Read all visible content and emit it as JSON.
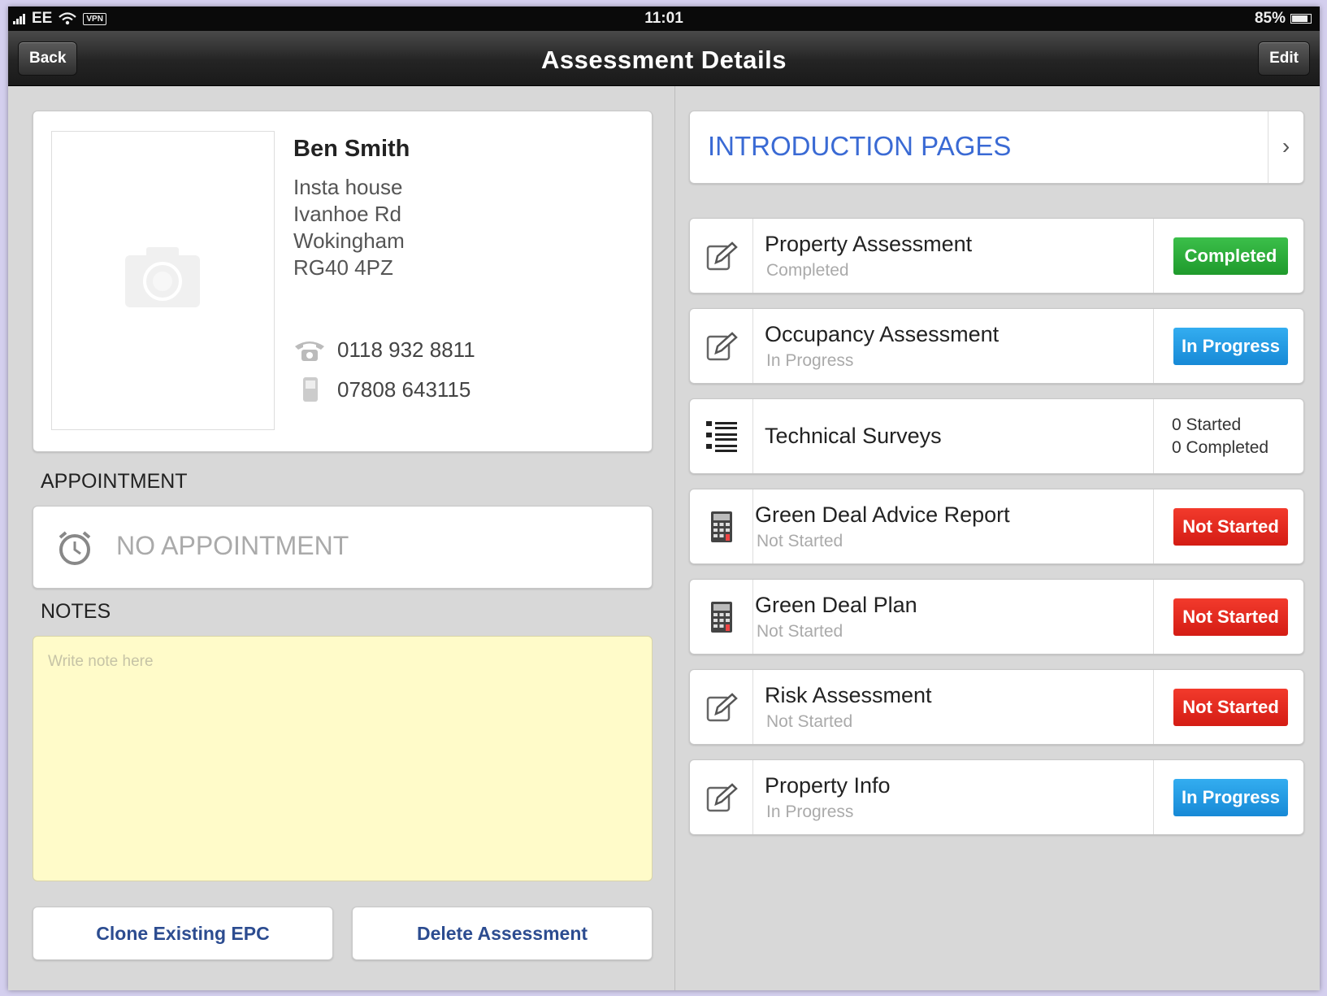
{
  "status_bar": {
    "carrier": "EE",
    "vpn": "VPN",
    "time": "11:01",
    "battery": "85%"
  },
  "nav": {
    "back_label": "Back",
    "title": "Assessment Details",
    "edit_label": "Edit"
  },
  "contact": {
    "name": "Ben Smith",
    "address_lines": [
      "Insta house",
      "Ivanhoe Rd",
      "Wokingham",
      "RG40 4PZ"
    ],
    "phone": "0118 932 8811",
    "mobile": "07808 643115"
  },
  "appointment": {
    "section_label": "APPOINTMENT",
    "text": "NO APPOINTMENT"
  },
  "notes": {
    "section_label": "NOTES",
    "placeholder": "Write note here"
  },
  "actions": {
    "clone_label": "Clone Existing EPC",
    "delete_label": "Delete Assessment"
  },
  "intro": {
    "label": "INTRODUCTION PAGES"
  },
  "assessments": [
    {
      "title": "Property Assessment",
      "subtitle": "Completed",
      "badge": "Completed",
      "icon": "edit-icon",
      "badge_color": "#2aae3a"
    },
    {
      "title": "Occupancy Assessment",
      "subtitle": "In Progress",
      "badge": "In Progress",
      "icon": "edit-icon",
      "badge_color": "#1e9ae6"
    },
    {
      "title": "Technical Surveys",
      "counts": [
        "0 Started",
        "0 Completed"
      ],
      "icon": "list-icon"
    },
    {
      "title": "Green Deal Advice Report",
      "subtitle": "Not Started",
      "badge": "Not Started",
      "icon": "calculator-icon",
      "badge_color": "#e62a1f"
    },
    {
      "title": "Green Deal Plan",
      "subtitle": "Not Started",
      "badge": "Not Started",
      "icon": "calculator-icon",
      "badge_color": "#e62a1f"
    },
    {
      "title": "Risk Assessment",
      "subtitle": "Not Started",
      "badge": "Not Started",
      "icon": "edit-icon",
      "badge_color": "#e62a1f"
    },
    {
      "title": "Property Info",
      "subtitle": "In Progress",
      "badge": "In Progress",
      "icon": "edit-icon",
      "badge_color": "#1e9ae6"
    }
  ]
}
